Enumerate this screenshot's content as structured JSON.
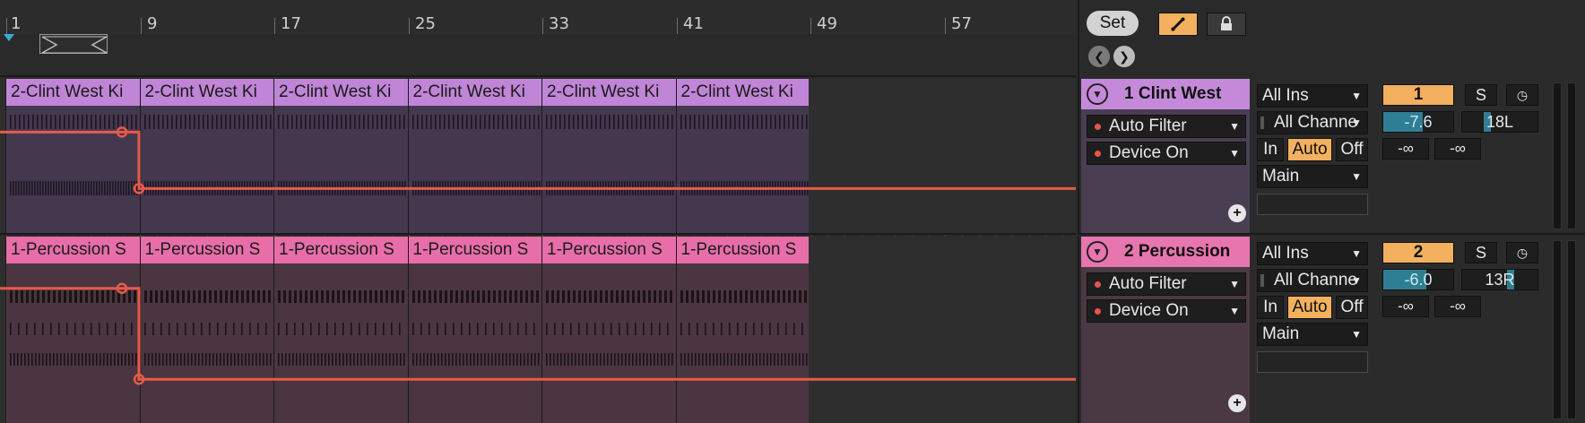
{
  "ruler": {
    "bars": [
      "1",
      "9",
      "17",
      "25",
      "33",
      "41",
      "49",
      "57"
    ]
  },
  "toolbar": {
    "set_label": "Set",
    "draw_icon": "pencil-icon",
    "lock_icon": "lock-icon",
    "back_icon": "arrow-left-icon",
    "forward_icon": "arrow-right-icon"
  },
  "tracks": [
    {
      "clip_name": "2-Clint West Ki",
      "name": "1 Clint West",
      "color": "#c48ad9",
      "clip_color": "#c085d7",
      "devices": [
        "Auto Filter",
        "Device On"
      ],
      "input_type": "All Ins",
      "input_channel": "All Channe",
      "monitor": {
        "in": "In",
        "auto": "Auto",
        "off": "Off",
        "active": "Auto"
      },
      "output": "Main",
      "number": "1",
      "solo": "S",
      "volume": "-7.6",
      "volume_level": 0.55,
      "pan": "18L",
      "pan_value": -0.36,
      "peak_left": "-∞",
      "peak_right": "-∞",
      "automation": {
        "high": 0.18,
        "low": 0.68,
        "break_bar": 9
      }
    },
    {
      "clip_name": "1-Percussion S",
      "name": "2 Percussion",
      "color": "#e775ae",
      "clip_color": "#e76ea8",
      "devices": [
        "Auto Filter",
        "Device On"
      ],
      "input_type": "All Ins",
      "input_channel": "All Channe",
      "monitor": {
        "in": "In",
        "auto": "Auto",
        "off": "Off",
        "active": "Auto"
      },
      "output": "Main",
      "number": "2",
      "solo": "S",
      "volume": "-6.0",
      "volume_level": 0.6,
      "pan": "13R",
      "pan_value": 0.26,
      "peak_left": "-∞",
      "peak_right": "-∞",
      "automation": {
        "high": 0.22,
        "low": 0.78,
        "break_bar": 9
      }
    }
  ]
}
